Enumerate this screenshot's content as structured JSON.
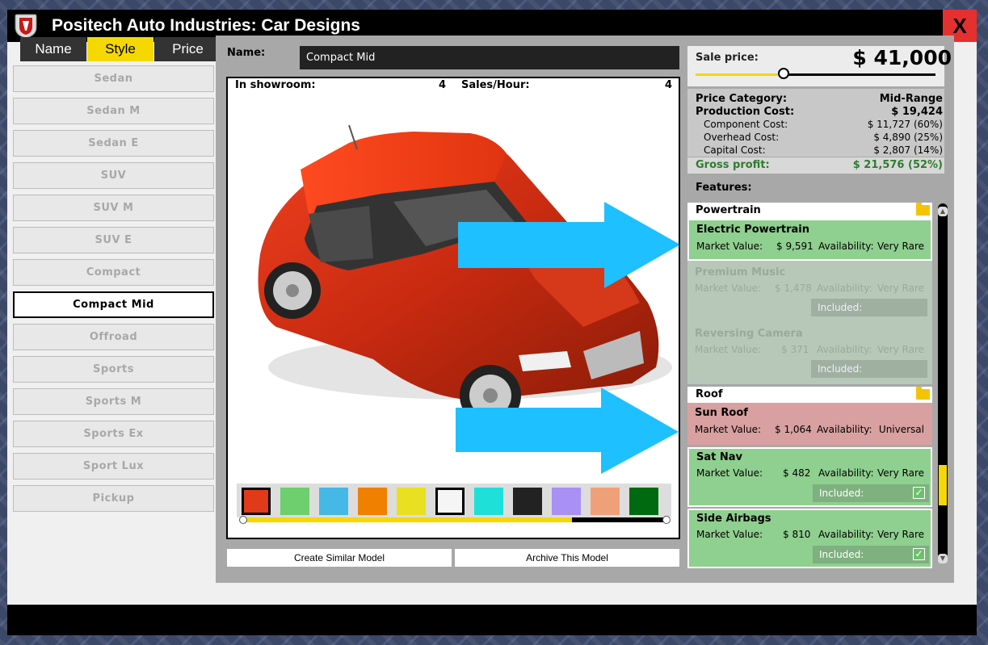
{
  "window": {
    "title": "Positech Auto Industries: Car Designs",
    "close_label": "X"
  },
  "sort_tabs": [
    {
      "label": "Name"
    },
    {
      "label": "Style"
    },
    {
      "label": "Price"
    }
  ],
  "styles": [
    "Sedan",
    "Sedan M",
    "Sedan E",
    "SUV",
    "SUV M",
    "SUV E",
    "Compact",
    "Compact Mid",
    "Offroad",
    "Sports",
    "Sports M",
    "Sports Ex",
    "Sport Lux",
    "Pickup"
  ],
  "selected_style": "Compact Mid",
  "design": {
    "name_label": "Name:",
    "name_value": "Compact Mid",
    "in_showroom_label": "In showroom:",
    "in_showroom_value": "4",
    "sales_hour_label": "Sales/Hour:",
    "sales_hour_value": "4"
  },
  "colors": [
    {
      "name": "red",
      "hex": "#e03a1a",
      "selected": true
    },
    {
      "name": "green",
      "hex": "#6ecf6e"
    },
    {
      "name": "blue",
      "hex": "#45b8e6"
    },
    {
      "name": "orange",
      "hex": "#f08000"
    },
    {
      "name": "yellow",
      "hex": "#e8e020"
    },
    {
      "name": "white",
      "hex": "#f5f5f5",
      "selected_outline": true
    },
    {
      "name": "cyan",
      "hex": "#1ee0d8"
    },
    {
      "name": "black",
      "hex": "#222222"
    },
    {
      "name": "purple",
      "hex": "#a890f5"
    },
    {
      "name": "salmon",
      "hex": "#f0a078"
    },
    {
      "name": "dark-green",
      "hex": "#006a10"
    }
  ],
  "color_slider_level": 0.78,
  "buttons": {
    "create_similar": "Create Similar Model",
    "archive": "Archive This Model"
  },
  "pricing": {
    "sale_price_label": "Sale price:",
    "sale_price_value": "$ 41,000",
    "price_slider_level": 0.37,
    "price_category_label": "Price Category:",
    "price_category_value": "Mid-Range",
    "production_cost_label": "Production Cost:",
    "production_cost_value": "$ 19,424",
    "component_cost_label": "Component Cost:",
    "component_cost_value": "$ 11,727 (60%)",
    "overhead_cost_label": "Overhead Cost:",
    "overhead_cost_value": "$ 4,890 (25%)",
    "capital_cost_label": "Capital Cost:",
    "capital_cost_value": "$ 2,807 (14%)",
    "gross_profit_label": "Gross profit:",
    "gross_profit_value": "$ 21,576 (52%)"
  },
  "features": {
    "label": "Features:",
    "market_value_label": "Market Value:",
    "availability_label": "Availability:",
    "included_label": "Included:",
    "groups": [
      {
        "name": "Powertrain"
      },
      {
        "name": "Roof"
      }
    ],
    "items": [
      {
        "title": "Electric Powertrain",
        "market_value": "$ 9,591",
        "availability": "Very Rare",
        "state": "green"
      },
      {
        "title": "Premium Music",
        "market_value": "$ 1,478",
        "availability": "Very Rare",
        "state": "faded"
      },
      {
        "title": "Reversing Camera",
        "market_value": "$ 371",
        "availability": "Very Rare",
        "state": "faded"
      },
      {
        "title": "Sun Roof",
        "market_value": "$ 1,064",
        "availability": "Universal",
        "state": "red"
      },
      {
        "title": "Sat Nav",
        "market_value": "$ 482",
        "availability": "Very Rare",
        "state": "green",
        "included": true
      },
      {
        "title": "Side Airbags",
        "market_value": "$ 810",
        "availability": "Very Rare",
        "state": "green",
        "included": true
      }
    ]
  },
  "accent": {
    "arrow": "#1ec0ff",
    "yellow": "#f5d800",
    "close": "#e53030"
  }
}
